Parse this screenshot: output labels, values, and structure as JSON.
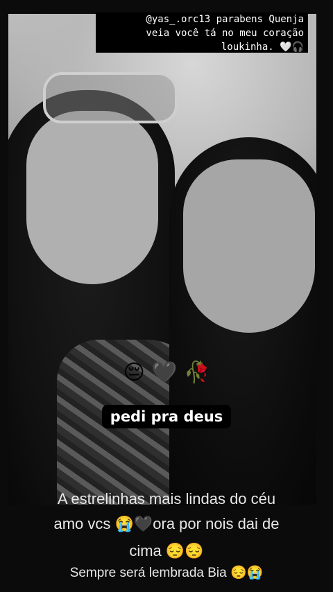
{
  "caption": {
    "line1": "@yas_.orc13 parabens Quenja",
    "line2": "veia você tá no meu coração",
    "line3": "loukinha. 🤍🎧"
  },
  "overlay": {
    "emojis": "😔 🖤 🥀",
    "sticker_text": "pedi pra deus"
  },
  "bottom_message": {
    "line1": "A estrelinhas mais lindas do céu",
    "line2": "amo vcs 😭🖤ora por nois dai de",
    "line3": "cima 😔😔",
    "line4": "Sempre será lembrada Bia 😔😭"
  },
  "colors": {
    "background": "#000000",
    "text": "#ffffff"
  }
}
